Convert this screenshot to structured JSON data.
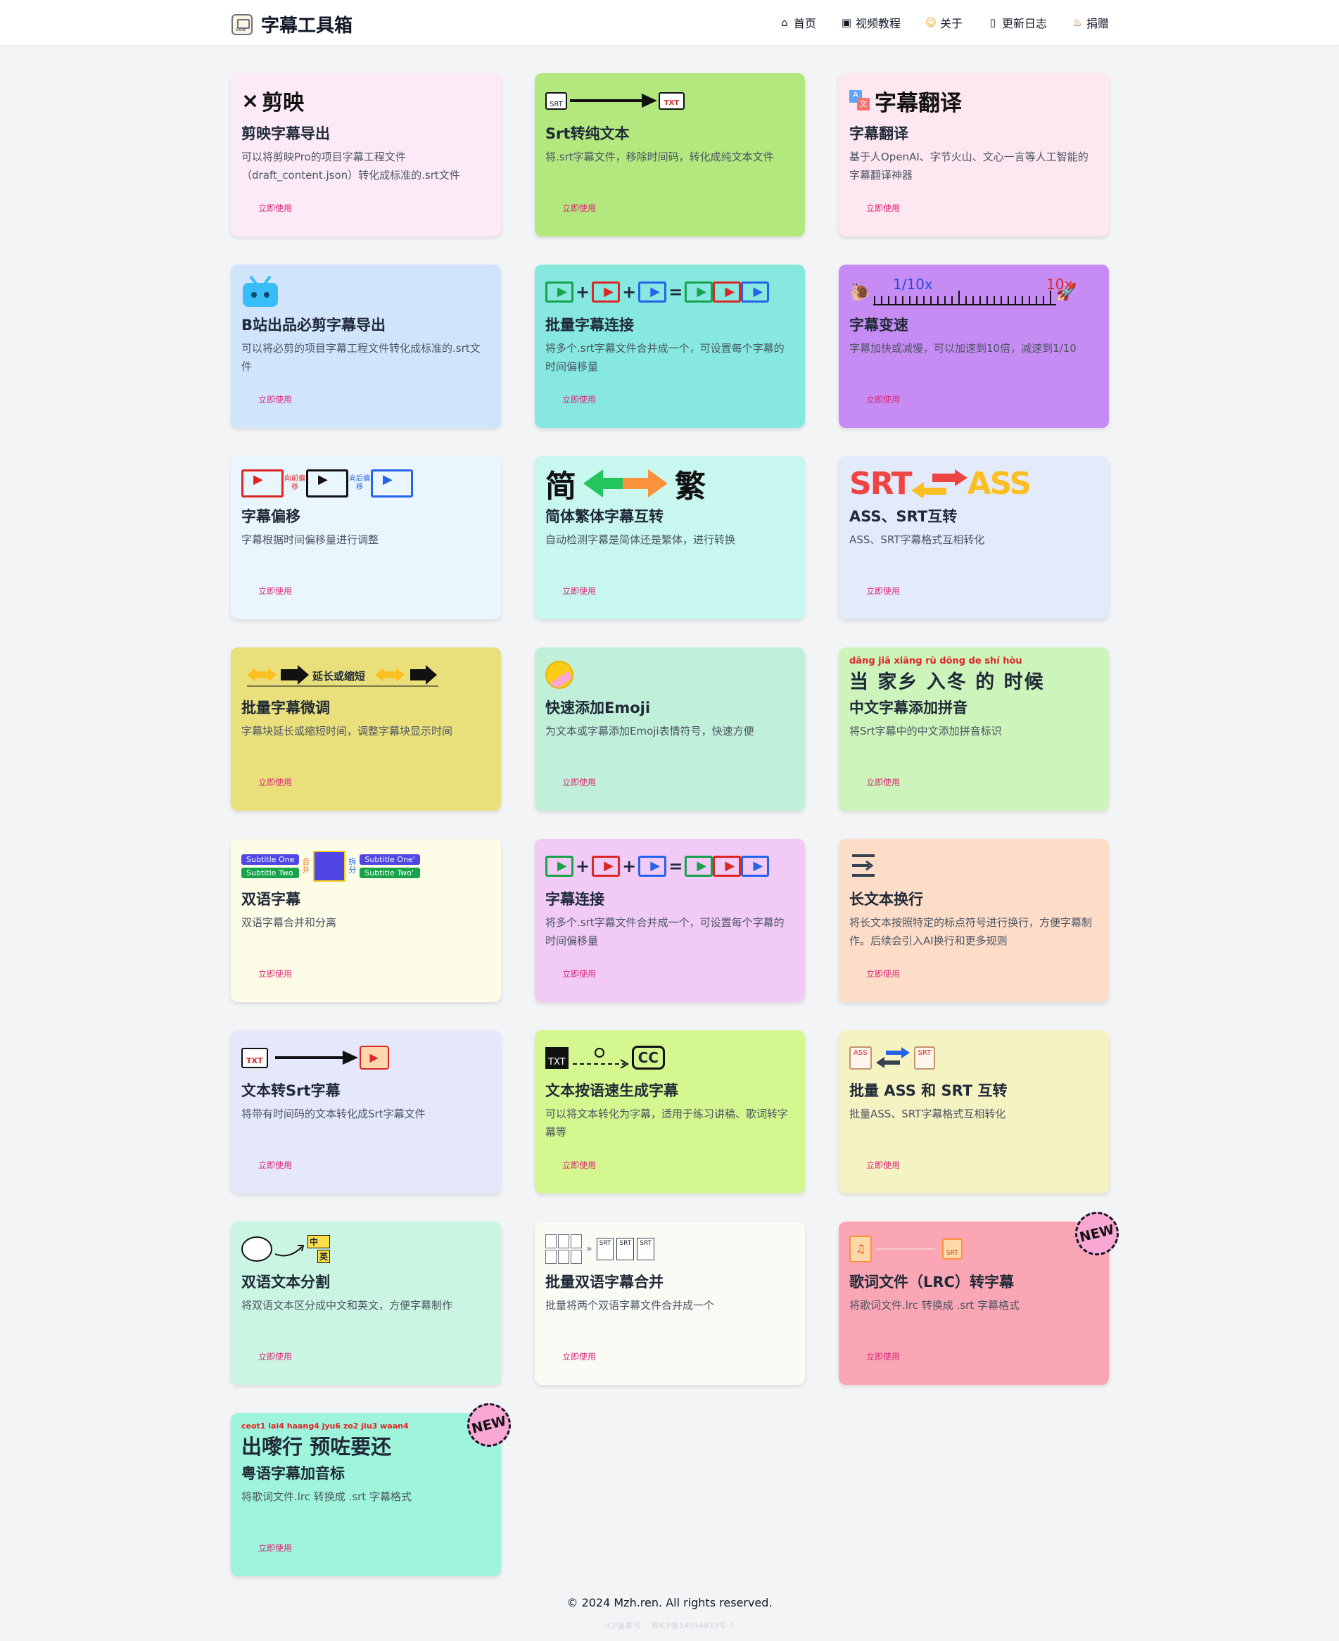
{
  "header": {
    "title": "字幕工具箱",
    "nav": [
      {
        "label": "首页",
        "icon": "⌂"
      },
      {
        "label": "视频教程",
        "icon": "▣"
      },
      {
        "label": "关于",
        "icon": "☺"
      },
      {
        "label": "更新日志",
        "icon": "▯"
      },
      {
        "label": "捐赠",
        "icon": "♨"
      }
    ]
  },
  "button_label": "立即使用",
  "new_badge": "NEW",
  "cards": [
    {
      "title": "剪映字幕导出",
      "desc": "可以将剪映Pro的项目字幕工程文件（draft_content.json）转化成标准的.srt文件",
      "bg": "#fdeaf7",
      "icon_text": "剪映"
    },
    {
      "title": "Srt转纯文本",
      "desc": "将.srt字幕文件，移除时间码，转化成纯文本文件",
      "bg": "#b3e87f",
      "icon_text": "SRT"
    },
    {
      "title": "字幕翻译",
      "desc": "基于人OpenAI、字节火山、文心一言等人工智能的字幕翻译神器",
      "bg": "#fde7f0",
      "icon_text": "字幕翻译"
    },
    {
      "title": "B站出品必剪字幕导出",
      "desc": "可以将必剪的项目字幕工程文件转化成标准的.srt文件",
      "bg": "#d0e4fb",
      "icon_text": ""
    },
    {
      "title": "批量字幕连接",
      "desc": "将多个.srt字幕文件合并成一个，可设置每个字幕的时间偏移量",
      "bg": "#86e8df",
      "icon_text": ""
    },
    {
      "title": "字幕变速",
      "desc": "字幕加快或减慢，可以加速到10倍，减速到1/10",
      "bg": "#c78cf4",
      "icon_text": "1/10x"
    },
    {
      "title": "字幕偏移",
      "desc": "字幕根据时间偏移量进行调整",
      "bg": "#eaf6fd",
      "icon_text": "向前偏移"
    },
    {
      "title": "简体繁体字幕互转",
      "desc": "自动检测字幕是简体还是繁体，进行转换",
      "bg": "#c7f7ee",
      "icon_text": "简"
    },
    {
      "title": "ASS、SRT互转",
      "desc": "ASS、SRT字幕格式互相转化",
      "bg": "#e3ebfb",
      "icon_text": "SRT"
    },
    {
      "title": "批量字幕微调",
      "desc": "字幕块延长或缩短时间，调整字幕块显示时间",
      "bg": "#e9e07c",
      "icon_text": "延长或缩短"
    },
    {
      "title": "快速添加Emoji",
      "desc": "为文本或字幕添加Emoji表情符号，快速方便",
      "bg": "#c1f0da",
      "icon_text": ""
    },
    {
      "title": "中文字幕添加拼音",
      "desc": "将Srt字幕中的中文添加拼音标识",
      "bg": "#cdf4bb",
      "icon_text": "当 家乡 入冬 的 时候"
    },
    {
      "title": "双语字幕",
      "desc": "双语字幕合并和分离",
      "bg": "#fdfce6",
      "icon_text": "Subtitle One"
    },
    {
      "title": "字幕连接",
      "desc": "将多个.srt字幕文件合并成一个，可设置每个字幕的时间偏移量",
      "bg": "#f1cbf5",
      "icon_text": ""
    },
    {
      "title": "长文本换行",
      "desc": "将长文本按照特定的标点符号进行换行，方便字幕制作。后续会引入AI换行和更多规则",
      "bg": "#fdddc8",
      "icon_text": ""
    },
    {
      "title": "文本转Srt字幕",
      "desc": "将带有时间码的文本转化成Srt字幕文件",
      "bg": "#e5e7fb",
      "icon_text": "TXT"
    },
    {
      "title": "文本按语速生成字幕",
      "desc": "可以将文本转化为字幕，适用于练习讲稿、歌词转字幕等",
      "bg": "#d4f78f",
      "icon_text": "TXT"
    },
    {
      "title": "批量 ASS 和 SRT 互转",
      "desc": "批量ASS、SRT字幕格式互相转化",
      "bg": "#f5f3c1",
      "icon_text": "ASS"
    },
    {
      "title": "双语文本分割",
      "desc": "将双语文本区分成中文和英文，方便字幕制作",
      "bg": "#cbf5e3",
      "icon_text": "中"
    },
    {
      "title": "批量双语字幕合并",
      "desc": "批量将两个双语字幕文件合并成一个",
      "bg": "#f9fbf4",
      "icon_text": "SRT"
    },
    {
      "title": "歌词文件（LRC）转字幕",
      "desc": "将歌词文件.lrc 转换成 .srt 字幕格式",
      "bg": "#fba6b4",
      "icon_text": "SRT",
      "is_new": true
    },
    {
      "title": "粤语字幕加音标",
      "desc": "将歌词文件.lrc 转换成 .srt 字幕格式",
      "bg": "#9ff5dc",
      "icon_text": "出嚟行 预咗要还",
      "is_new": true
    }
  ],
  "icon_details": {
    "speed_max": "10x",
    "pinyin_line": "dāng jiā xiāng  rù dōng  de  shí hòu",
    "jyutping_line": "ceot1 lai4 haang4  jyu6 zo2  jiu3 waan4",
    "trad": "繁",
    "ass_label": "ASS",
    "bilingual_en": "英",
    "shift_back": "向后偏移",
    "subtitle_two": "Subtitle Two",
    "subtitle_one_prime": "Subtitle One'",
    "subtitle_two_prime": "Subtitle Two'",
    "merge": "合并",
    "split": "拆分",
    "cc": "CC"
  },
  "footer": {
    "copyright": "© 2024 Mzh.ren. All rights reserved.",
    "icp": "ICP备案号： 粤ICP备14094833号-7"
  }
}
